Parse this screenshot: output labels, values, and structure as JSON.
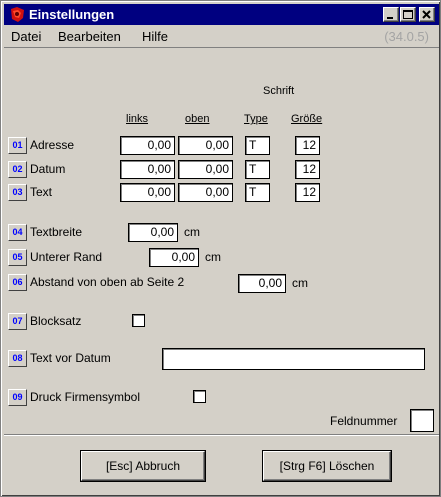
{
  "window": {
    "title": "Einstellungen",
    "icon": "app-red-icon",
    "controls": [
      "minimize-icon",
      "maximize-icon",
      "close-icon"
    ]
  },
  "menu": {
    "items": [
      {
        "label": "Datei"
      },
      {
        "label": "Bearbeiten"
      },
      {
        "label": "Hilfe"
      }
    ],
    "version": "(34.0.5)"
  },
  "headers": {
    "schrift": "Schrift",
    "links": "links",
    "oben": "oben",
    "type": "Type",
    "groesse": "Größe"
  },
  "rows": [
    {
      "num": "01",
      "label": "Adresse",
      "links": "0,00",
      "oben": "0,00",
      "type": "T",
      "groesse": "12"
    },
    {
      "num": "02",
      "label": "Datum",
      "links": "0,00",
      "oben": "0,00",
      "type": "T",
      "groesse": "12"
    },
    {
      "num": "03",
      "label": "Text",
      "links": "0,00",
      "oben": "0,00",
      "type": "T",
      "groesse": "12"
    }
  ],
  "textbreite": {
    "num": "04",
    "label": "Textbreite",
    "value": "0,00",
    "unit": "cm"
  },
  "unterer_rand": {
    "num": "05",
    "label": "Unterer Rand",
    "value": "0,00",
    "unit": "cm"
  },
  "abstand": {
    "num": "06",
    "label": "Abstand von oben ab Seite 2",
    "value": "0,00",
    "unit": "cm"
  },
  "blocksatz": {
    "num": "07",
    "label": "Blocksatz",
    "checked": false
  },
  "text_vor_datum": {
    "num": "08",
    "label": "Text vor Datum",
    "value": ""
  },
  "druck_firmensymbol": {
    "num": "09",
    "label": "Druck Firmensymbol",
    "checked": false
  },
  "feldnummer": {
    "label": "Feldnummer",
    "value": ""
  },
  "buttons": {
    "abbruch": "[Esc] Abbruch",
    "loeschen": "[Strg F6] Löschen"
  },
  "colors": {
    "titlebar": "#000080",
    "face": "#d4d0c8",
    "number_text": "#0000ff"
  }
}
